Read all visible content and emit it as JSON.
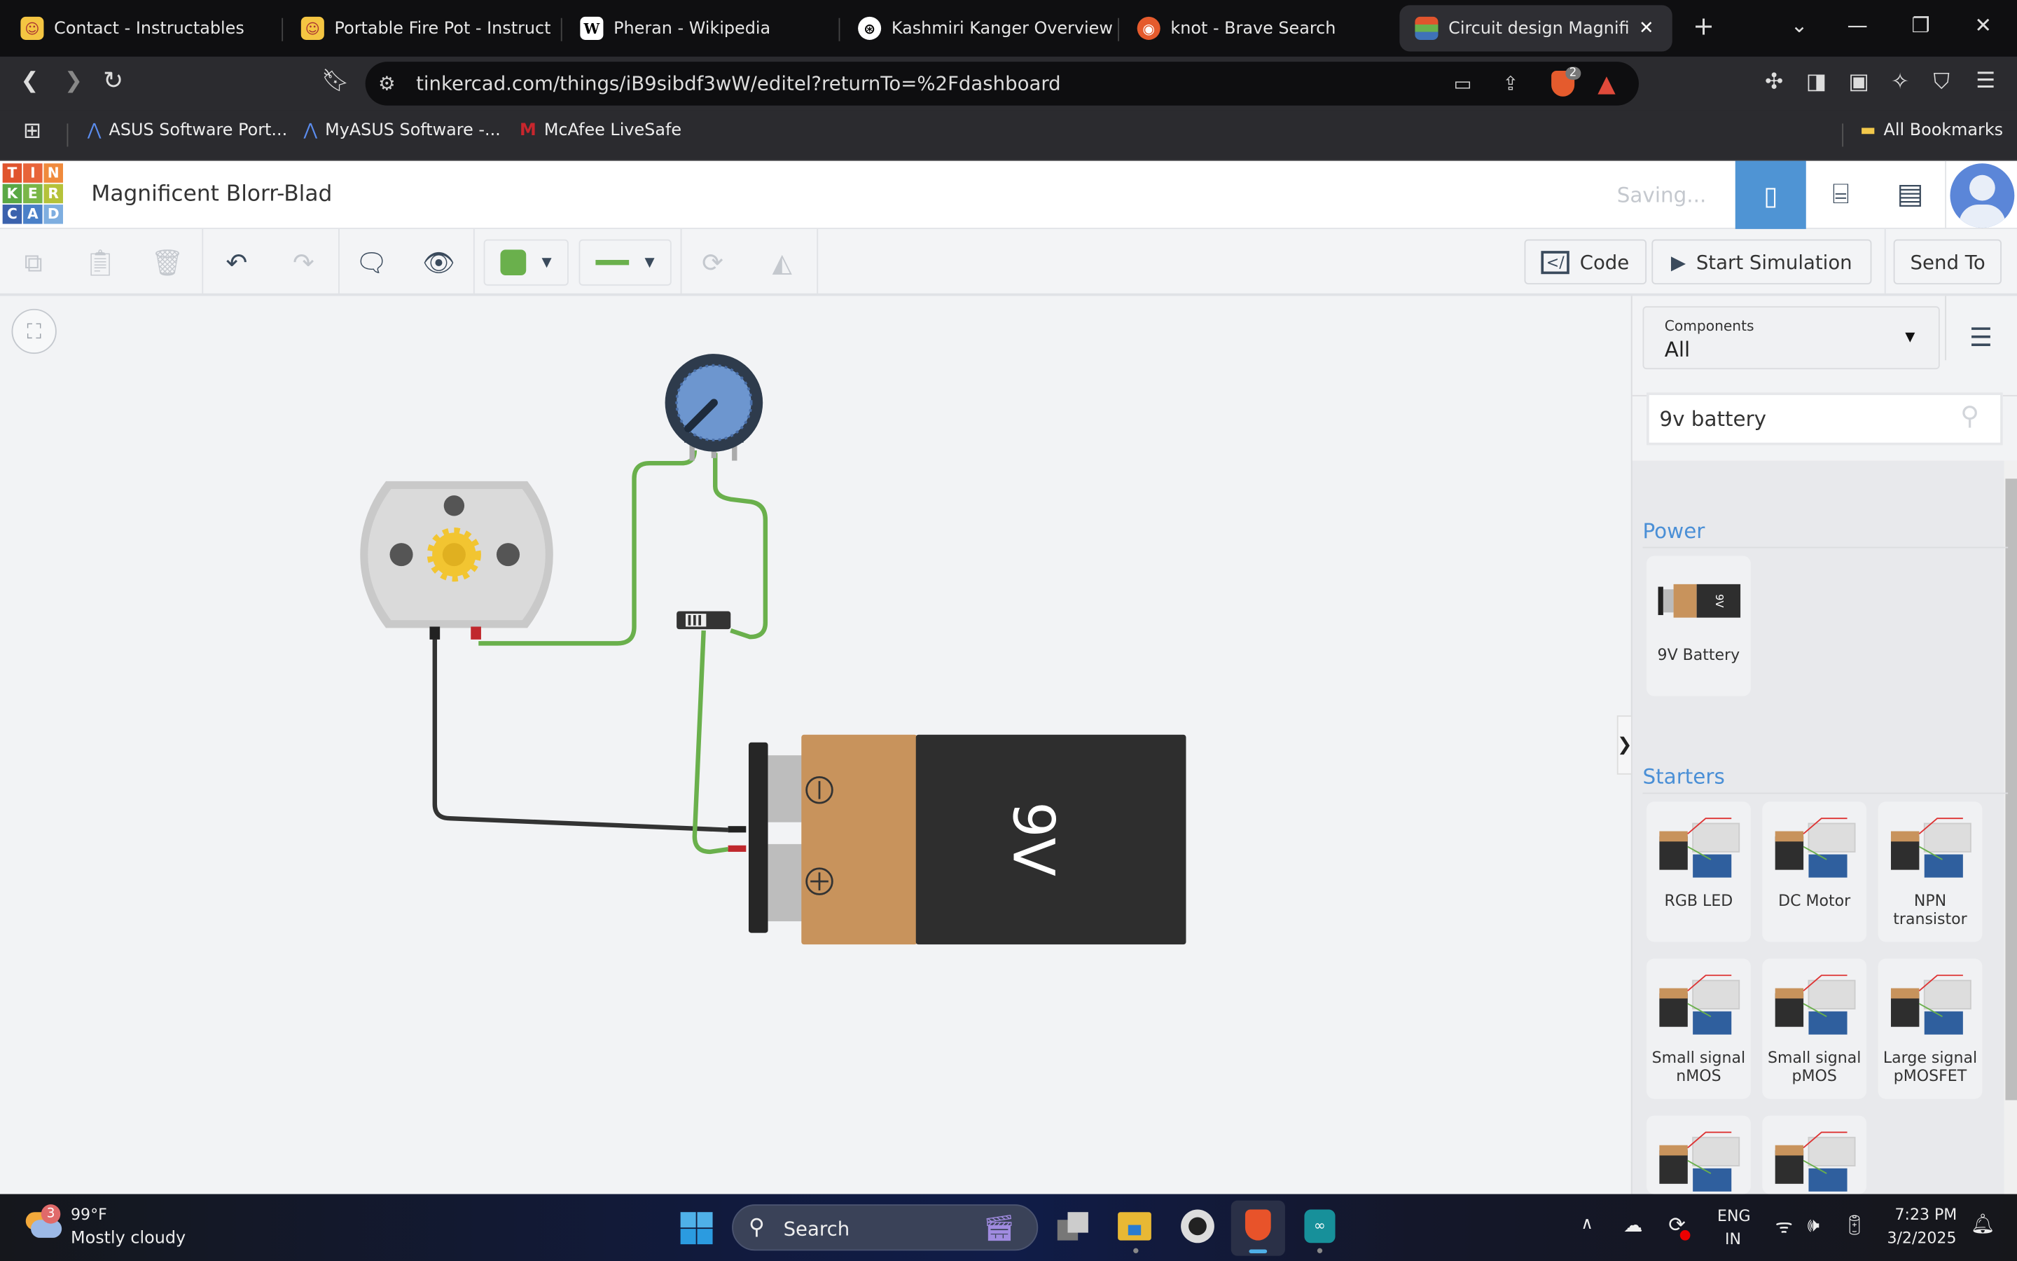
{
  "browser": {
    "tabs": [
      {
        "title": "Contact - Instructables",
        "icon": "instructables-icon"
      },
      {
        "title": "Portable Fire Pot - Instructab",
        "icon": "instructables-icon"
      },
      {
        "title": "Pheran - Wikipedia",
        "icon": "wikipedia-icon"
      },
      {
        "title": "Kashmiri Kanger Overview",
        "icon": "chatgpt-icon"
      },
      {
        "title": "knot - Brave Search",
        "icon": "brave-search-icon"
      },
      {
        "title": "Circuit design Magnifice",
        "icon": "tinkercad-icon",
        "active": true
      }
    ],
    "url": "tinkercad.com/things/iB9sibdf3wW/editel?returnTo=%2Fdashboard",
    "brave_badge": "2",
    "bookmarks": [
      {
        "label": "ASUS Software Port..."
      },
      {
        "label": "MyASUS Software -..."
      },
      {
        "label": "McAfee LiveSafe"
      }
    ],
    "all_bookmarks": "All Bookmarks"
  },
  "app": {
    "logo_letters": [
      "T",
      "I",
      "N",
      "K",
      "E",
      "R",
      "C",
      "A",
      "D"
    ],
    "title": "Magnificent Blorr-Blad",
    "status": "Saving...",
    "accent": "#4f94d4"
  },
  "toolbar": {
    "code": "Code",
    "start_simulation": "Start Simulation",
    "send_to": "Send To",
    "wire_color": "#6ab04c"
  },
  "circuit": {
    "battery_label": "9V"
  },
  "panel": {
    "components_label": "Components",
    "components_value": "All",
    "search_value": "9v battery",
    "sections": [
      {
        "title": "Power",
        "items": [
          {
            "label": "9V Battery"
          }
        ]
      },
      {
        "title": "Starters",
        "items": [
          {
            "label": "RGB LED"
          },
          {
            "label": "DC Motor"
          },
          {
            "label": "NPN transistor"
          },
          {
            "label": "Small signal nMOS"
          },
          {
            "label": "Small signal pMOS"
          },
          {
            "label": "Large signal pMOSFET"
          },
          {
            "label": ""
          },
          {
            "label": ""
          }
        ]
      }
    ]
  },
  "taskbar": {
    "weather_temp": "99°F",
    "weather_desc": "Mostly cloudy",
    "weather_badge": "3",
    "search": "Search",
    "lang1": "ENG",
    "lang2": "IN",
    "time": "7:23 PM",
    "date": "3/2/2025"
  }
}
